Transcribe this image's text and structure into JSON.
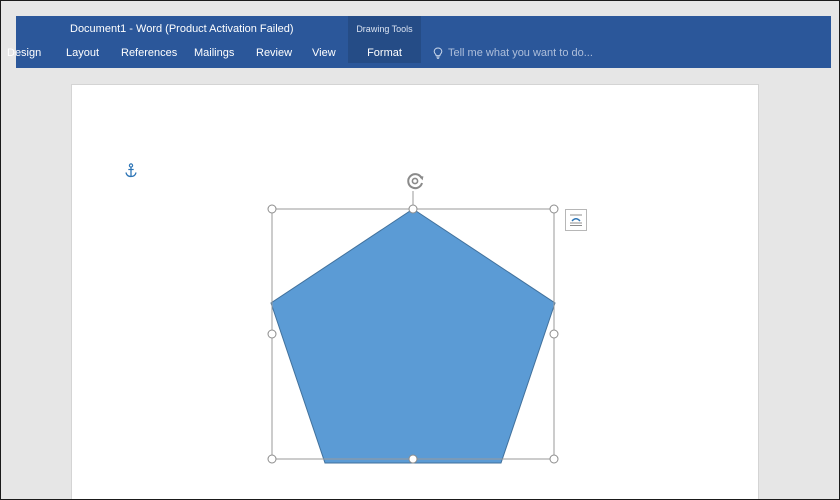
{
  "window": {
    "title": "Document1 - Word (Product Activation Failed)",
    "accent_color": "#2b579a"
  },
  "ribbon": {
    "contextual_group": "Drawing Tools",
    "tabs": [
      {
        "label": "Design"
      },
      {
        "label": "Layout"
      },
      {
        "label": "References"
      },
      {
        "label": "Mailings"
      },
      {
        "label": "Review"
      },
      {
        "label": "View"
      }
    ],
    "active_tab": "Format",
    "tell_me": {
      "placeholder": "Tell me what you want to do...",
      "icon": "lightbulb-icon"
    }
  },
  "document": {
    "shape": {
      "type": "pentagon",
      "fill_color": "#5b9bd5",
      "stroke_color": "#41719c",
      "selected": true
    },
    "icons": [
      "anchor-icon",
      "rotate-icon",
      "layout-options-icon"
    ]
  }
}
